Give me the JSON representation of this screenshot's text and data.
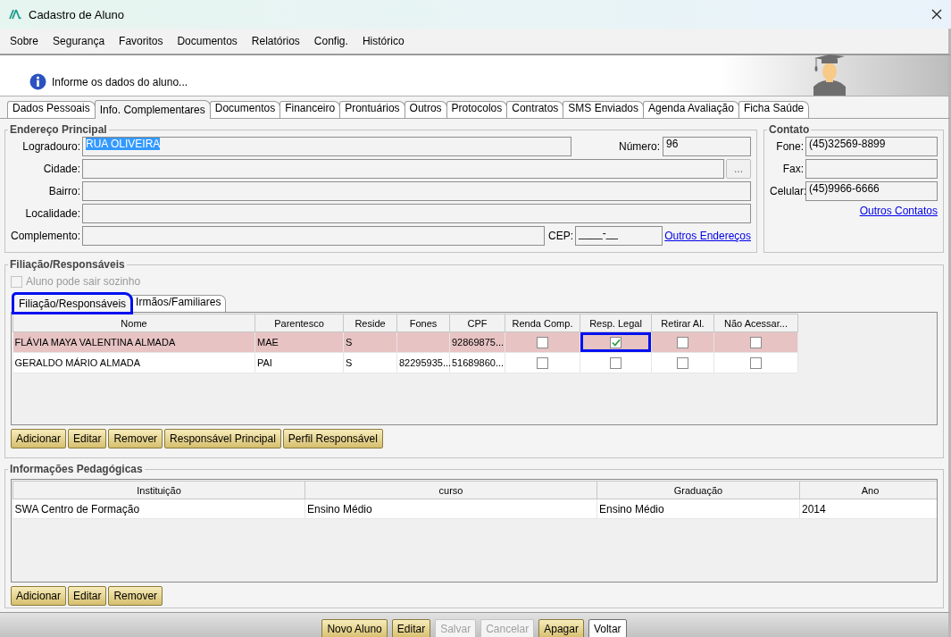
{
  "window": {
    "title": "Cadastro de Aluno"
  },
  "menu": [
    "Sobre",
    "Segurança",
    "Favoritos",
    "Documentos",
    "Relatórios",
    "Config.",
    "Histórico"
  ],
  "banner": {
    "message": "Informe os dados do aluno..."
  },
  "tabs": [
    {
      "label": "Dados Pessoais",
      "selected": false
    },
    {
      "label": "Info. Complementares",
      "selected": true
    },
    {
      "label": "Documentos",
      "selected": false
    },
    {
      "label": "Financeiro",
      "selected": false
    },
    {
      "label": "Prontuários",
      "selected": false
    },
    {
      "label": "Outros",
      "selected": false
    },
    {
      "label": "Protocolos",
      "selected": false
    },
    {
      "label": "Contratos",
      "selected": false
    },
    {
      "label": "SMS Enviados",
      "selected": false
    },
    {
      "label": "Agenda Avaliação",
      "selected": false
    },
    {
      "label": "Ficha Saúde",
      "selected": false
    }
  ],
  "address": {
    "title": "Endereço Principal",
    "logradouro": {
      "label": "Logradouro:",
      "value": "RUA OLIVEIRA",
      "text_selected": true
    },
    "numero": {
      "label": "Número:",
      "value": "96"
    },
    "cidade": {
      "label": "Cidade:",
      "lookup_button": "..."
    },
    "bairro": {
      "label": "Bairro:"
    },
    "localidade": {
      "label": "Localidade:"
    },
    "complemento": {
      "label": "Complemento:"
    },
    "cep": {
      "label": "CEP:",
      "value": "____-__"
    },
    "link": "Outros Endereços"
  },
  "contact": {
    "title": "Contato",
    "fields": [
      {
        "label": "Fone:",
        "value": "(45)32569-8899"
      },
      {
        "label": "Fax:"
      },
      {
        "label": "Celular:",
        "value": "(45)9966-6666"
      }
    ],
    "link": "Outros Contatos"
  },
  "guardians": {
    "title": "Filiação/Responsáveis",
    "alone_option": {
      "label": "Aluno pode sair sozinho",
      "checked": false,
      "disabled": true
    },
    "subtabs": [
      {
        "label": "Filiação/Responsáveis",
        "selected": true,
        "highlighted": true
      },
      {
        "label": "Irmãos/Familiares",
        "selected": false,
        "highlighted": false
      }
    ],
    "table": {
      "columns": [
        "Nome",
        "Parentesco",
        "Reside",
        "Fones",
        "CPF",
        "Renda Comp.",
        "Resp. Legal",
        "Retirar Al.",
        "Não Acessar..."
      ],
      "rows": [
        {
          "selected": true,
          "name": "FLÁVIA MAYA VALENTINA ALMADA",
          "relation": "MAE",
          "lives_with": "S",
          "cpf": "92869875...",
          "checks": [
            {
              "checked": false,
              "highlighted": false
            },
            {
              "checked": true,
              "highlighted": true
            },
            {
              "checked": false,
              "highlighted": false
            },
            {
              "checked": false,
              "highlighted": false
            }
          ]
        },
        {
          "selected": false,
          "name": "GERALDO MÁRIO ALMADA",
          "relation": "PAI",
          "lives_with": "S",
          "phones": "82295935...",
          "cpf": "51689860...",
          "checks": [
            {
              "checked": false,
              "highlighted": false
            },
            {
              "checked": false,
              "highlighted": false
            },
            {
              "checked": false,
              "highlighted": false
            },
            {
              "checked": false,
              "highlighted": false
            }
          ]
        }
      ]
    },
    "buttons": [
      "Adicionar",
      "Editar",
      "Remover",
      "Responsável Principal",
      "Perfil Responsável"
    ]
  },
  "education": {
    "title": "Informações Pedagógicas",
    "table": {
      "columns": [
        "Instituição",
        "curso",
        "Graduação",
        "Ano"
      ],
      "rows": [
        [
          "SWA Centro de Formação",
          "Ensino Médio",
          "Ensino Médio",
          "2014"
        ]
      ]
    },
    "buttons": [
      "Adicionar",
      "Editar",
      "Remover"
    ]
  },
  "footer_buttons": [
    {
      "label": "Novo Aluno",
      "disabled": false,
      "focused": false
    },
    {
      "label": "Editar",
      "disabled": false,
      "focused": false
    },
    {
      "label": "Salvar",
      "disabled": true,
      "focused": false
    },
    {
      "label": "Cancelar",
      "disabled": true,
      "focused": false
    },
    {
      "label": "Apagar",
      "disabled": false,
      "focused": false
    },
    {
      "label": "Voltar",
      "disabled": false,
      "focused": true
    }
  ]
}
